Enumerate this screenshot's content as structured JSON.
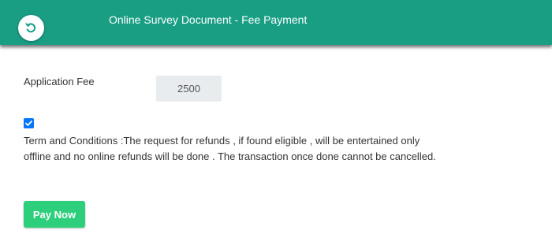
{
  "header": {
    "title": "Online Survey Document - Fee Payment",
    "back_icon": "refresh-back-icon",
    "bg_color": "#199e84"
  },
  "form": {
    "fee_label": "Application Fee",
    "fee_value": "2500",
    "terms_checked": true,
    "terms_text": "Term and Conditions :The request for refunds , if found eligible , will be entertained only offline and no online refunds will be done . The transaction once done cannot be cancelled.",
    "pay_button_label": "Pay Now",
    "pay_button_color": "#2ecf7c"
  }
}
